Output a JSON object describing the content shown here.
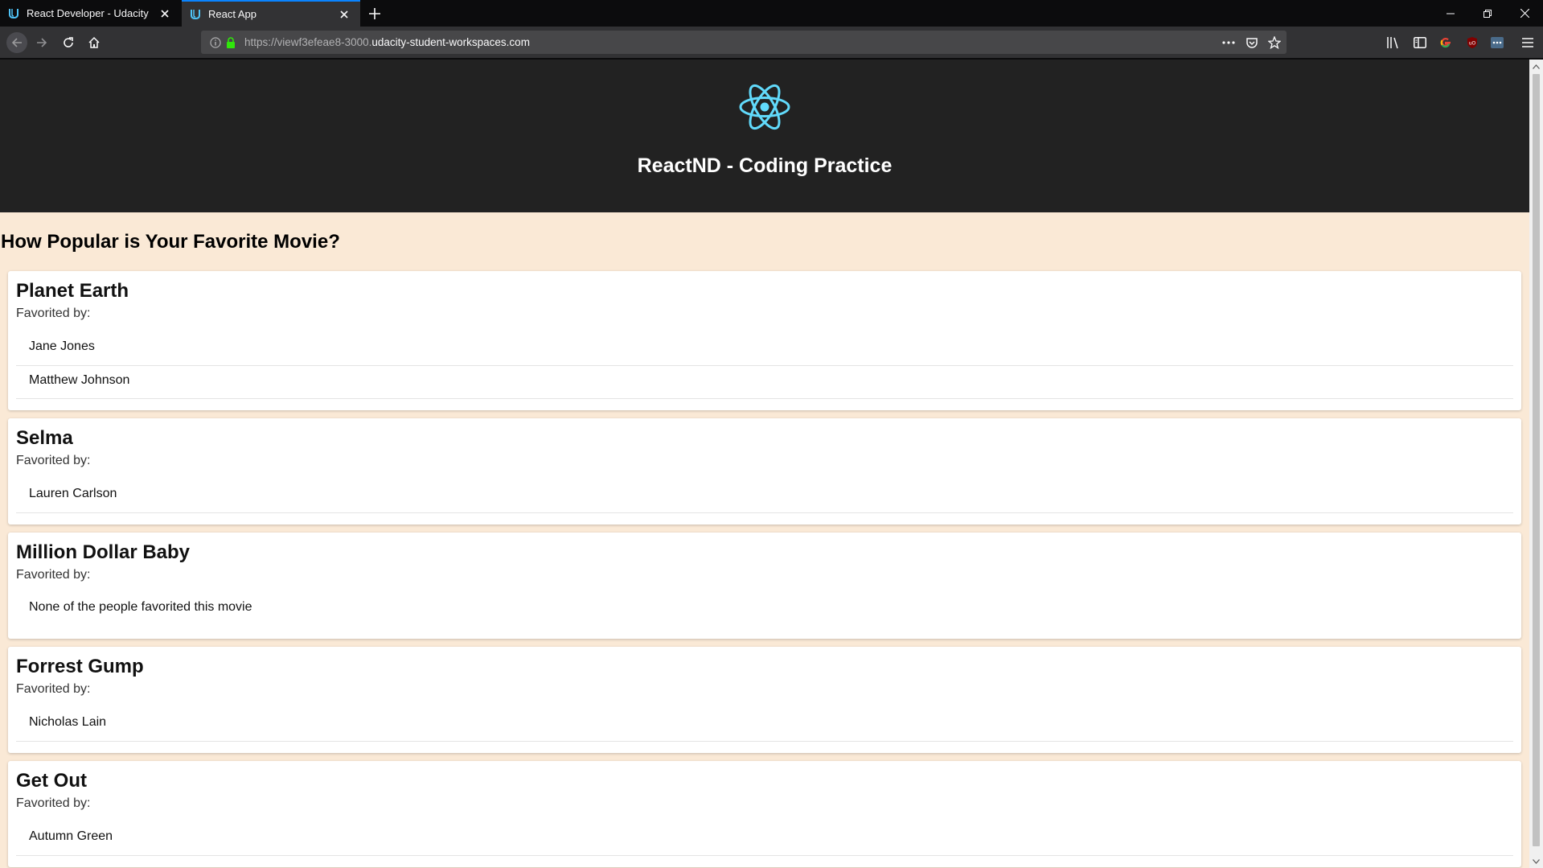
{
  "browser": {
    "tabs": [
      {
        "title": "React Developer - Udacity",
        "active": false
      },
      {
        "title": "React App",
        "active": true
      }
    ],
    "url_prefix": "https://viewf3efeae8-3000.",
    "url_host": "udacity-student-workspaces.com",
    "accent_color": "#0a84ff"
  },
  "header": {
    "logo_icon": "react-atom-icon",
    "title": "ReactND - Coding Practice",
    "logo_color": "#61dafb"
  },
  "page": {
    "heading": "How Popular is Your Favorite Movie?",
    "favorited_label": "Favorited by:",
    "movies": [
      {
        "title": "Planet Earth",
        "fans": [
          "Jane Jones",
          "Matthew Johnson"
        ]
      },
      {
        "title": "Selma",
        "fans": [
          "Lauren Carlson"
        ]
      },
      {
        "title": "Million Dollar Baby",
        "fans": [],
        "empty_message": "None of the people favorited this movie"
      },
      {
        "title": "Forrest Gump",
        "fans": [
          "Nicholas Lain"
        ]
      },
      {
        "title": "Get Out",
        "fans": [
          "Autumn Green"
        ]
      }
    ]
  }
}
